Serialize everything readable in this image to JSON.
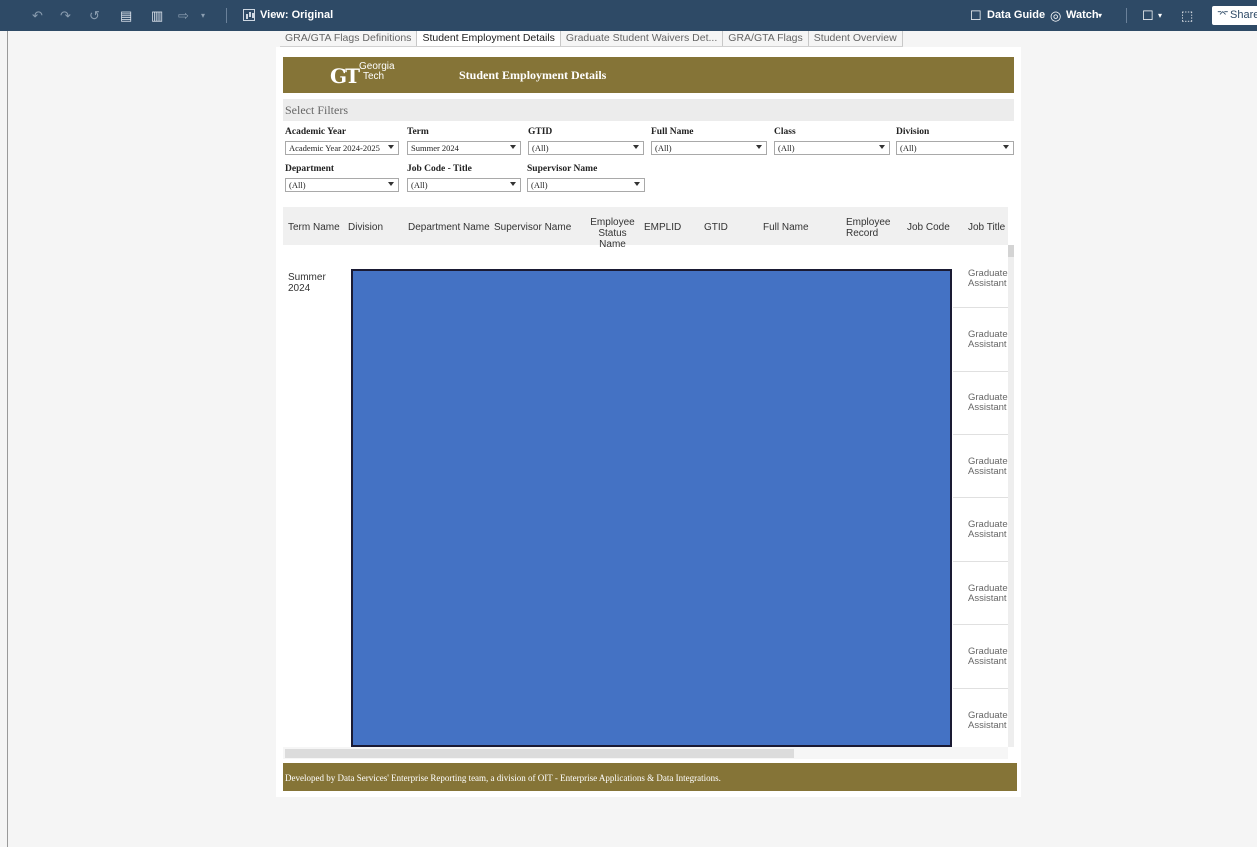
{
  "toolbar": {
    "view_label": "View: Original",
    "data_guide": "Data Guide",
    "watch": "Watch",
    "share": "Share"
  },
  "tabs": [
    {
      "label": "GRA/GTA Flags Definitions"
    },
    {
      "label": "Student Employment Details"
    },
    {
      "label": "Graduate Student Waivers Det..."
    },
    {
      "label": "GRA/GTA Flags"
    },
    {
      "label": "Student Overview"
    }
  ],
  "banner": {
    "logo_mark": "GT",
    "logo_line1": "Georgia",
    "logo_line2": "Tech",
    "title": "Student Employment Details"
  },
  "filters": {
    "heading": "Select Filters",
    "items": [
      {
        "label": "Academic Year",
        "value": "Academic Year 2024-2025"
      },
      {
        "label": "Term",
        "value": "Summer 2024"
      },
      {
        "label": "GTID",
        "value": "(All)"
      },
      {
        "label": "Full Name",
        "value": "(All)"
      },
      {
        "label": "Class",
        "value": "(All)"
      },
      {
        "label": "Division",
        "value": "(All)"
      },
      {
        "label": "Department",
        "value": "(All)"
      },
      {
        "label": "Job Code - Title",
        "value": "(All)"
      },
      {
        "label": "Supervisor Name",
        "value": "(All)"
      }
    ]
  },
  "table": {
    "headers": [
      "Term Name",
      "Division",
      "Department Name",
      "Supervisor Name",
      "Employee Status Name",
      "EMPLID",
      "GTID",
      "Full Name",
      "Employee Record",
      "Job Code",
      "Job Title"
    ],
    "term_cell": "Summer 2024",
    "job_titles": [
      "Graduate Assistant",
      "Graduate Assistant",
      "Graduate Assistant",
      "Graduate Assistant",
      "Graduate Assistant",
      "Graduate Assistant",
      "Graduate Assistant",
      "Graduate Assistant"
    ]
  },
  "footer": {
    "text": "Developed by Data Services' Enterprise Reporting team, a division of OIT - Enterprise Applications & Data Integrations."
  }
}
